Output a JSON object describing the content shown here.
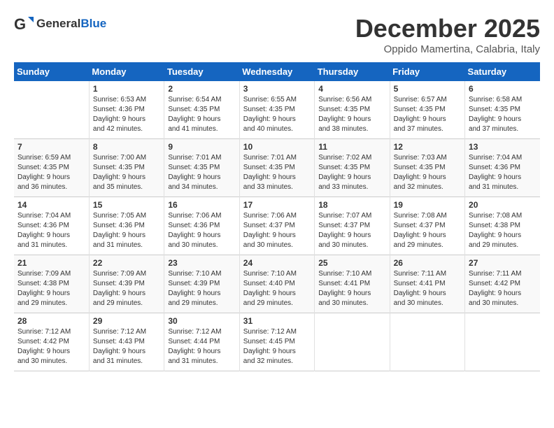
{
  "header": {
    "logo_general": "General",
    "logo_blue": "Blue",
    "month_title": "December 2025",
    "location": "Oppido Mamertina, Calabria, Italy"
  },
  "weekdays": [
    "Sunday",
    "Monday",
    "Tuesday",
    "Wednesday",
    "Thursday",
    "Friday",
    "Saturday"
  ],
  "weeks": [
    [
      {
        "day": "",
        "info": ""
      },
      {
        "day": "1",
        "info": "Sunrise: 6:53 AM\nSunset: 4:36 PM\nDaylight: 9 hours\nand 42 minutes."
      },
      {
        "day": "2",
        "info": "Sunrise: 6:54 AM\nSunset: 4:35 PM\nDaylight: 9 hours\nand 41 minutes."
      },
      {
        "day": "3",
        "info": "Sunrise: 6:55 AM\nSunset: 4:35 PM\nDaylight: 9 hours\nand 40 minutes."
      },
      {
        "day": "4",
        "info": "Sunrise: 6:56 AM\nSunset: 4:35 PM\nDaylight: 9 hours\nand 38 minutes."
      },
      {
        "day": "5",
        "info": "Sunrise: 6:57 AM\nSunset: 4:35 PM\nDaylight: 9 hours\nand 37 minutes."
      },
      {
        "day": "6",
        "info": "Sunrise: 6:58 AM\nSunset: 4:35 PM\nDaylight: 9 hours\nand 37 minutes."
      }
    ],
    [
      {
        "day": "7",
        "info": "Sunrise: 6:59 AM\nSunset: 4:35 PM\nDaylight: 9 hours\nand 36 minutes."
      },
      {
        "day": "8",
        "info": "Sunrise: 7:00 AM\nSunset: 4:35 PM\nDaylight: 9 hours\nand 35 minutes."
      },
      {
        "day": "9",
        "info": "Sunrise: 7:01 AM\nSunset: 4:35 PM\nDaylight: 9 hours\nand 34 minutes."
      },
      {
        "day": "10",
        "info": "Sunrise: 7:01 AM\nSunset: 4:35 PM\nDaylight: 9 hours\nand 33 minutes."
      },
      {
        "day": "11",
        "info": "Sunrise: 7:02 AM\nSunset: 4:35 PM\nDaylight: 9 hours\nand 33 minutes."
      },
      {
        "day": "12",
        "info": "Sunrise: 7:03 AM\nSunset: 4:35 PM\nDaylight: 9 hours\nand 32 minutes."
      },
      {
        "day": "13",
        "info": "Sunrise: 7:04 AM\nSunset: 4:36 PM\nDaylight: 9 hours\nand 31 minutes."
      }
    ],
    [
      {
        "day": "14",
        "info": "Sunrise: 7:04 AM\nSunset: 4:36 PM\nDaylight: 9 hours\nand 31 minutes."
      },
      {
        "day": "15",
        "info": "Sunrise: 7:05 AM\nSunset: 4:36 PM\nDaylight: 9 hours\nand 31 minutes."
      },
      {
        "day": "16",
        "info": "Sunrise: 7:06 AM\nSunset: 4:36 PM\nDaylight: 9 hours\nand 30 minutes."
      },
      {
        "day": "17",
        "info": "Sunrise: 7:06 AM\nSunset: 4:37 PM\nDaylight: 9 hours\nand 30 minutes."
      },
      {
        "day": "18",
        "info": "Sunrise: 7:07 AM\nSunset: 4:37 PM\nDaylight: 9 hours\nand 30 minutes."
      },
      {
        "day": "19",
        "info": "Sunrise: 7:08 AM\nSunset: 4:37 PM\nDaylight: 9 hours\nand 29 minutes."
      },
      {
        "day": "20",
        "info": "Sunrise: 7:08 AM\nSunset: 4:38 PM\nDaylight: 9 hours\nand 29 minutes."
      }
    ],
    [
      {
        "day": "21",
        "info": "Sunrise: 7:09 AM\nSunset: 4:38 PM\nDaylight: 9 hours\nand 29 minutes."
      },
      {
        "day": "22",
        "info": "Sunrise: 7:09 AM\nSunset: 4:39 PM\nDaylight: 9 hours\nand 29 minutes."
      },
      {
        "day": "23",
        "info": "Sunrise: 7:10 AM\nSunset: 4:39 PM\nDaylight: 9 hours\nand 29 minutes."
      },
      {
        "day": "24",
        "info": "Sunrise: 7:10 AM\nSunset: 4:40 PM\nDaylight: 9 hours\nand 29 minutes."
      },
      {
        "day": "25",
        "info": "Sunrise: 7:10 AM\nSunset: 4:41 PM\nDaylight: 9 hours\nand 30 minutes."
      },
      {
        "day": "26",
        "info": "Sunrise: 7:11 AM\nSunset: 4:41 PM\nDaylight: 9 hours\nand 30 minutes."
      },
      {
        "day": "27",
        "info": "Sunrise: 7:11 AM\nSunset: 4:42 PM\nDaylight: 9 hours\nand 30 minutes."
      }
    ],
    [
      {
        "day": "28",
        "info": "Sunrise: 7:12 AM\nSunset: 4:42 PM\nDaylight: 9 hours\nand 30 minutes."
      },
      {
        "day": "29",
        "info": "Sunrise: 7:12 AM\nSunset: 4:43 PM\nDaylight: 9 hours\nand 31 minutes."
      },
      {
        "day": "30",
        "info": "Sunrise: 7:12 AM\nSunset: 4:44 PM\nDaylight: 9 hours\nand 31 minutes."
      },
      {
        "day": "31",
        "info": "Sunrise: 7:12 AM\nSunset: 4:45 PM\nDaylight: 9 hours\nand 32 minutes."
      },
      {
        "day": "",
        "info": ""
      },
      {
        "day": "",
        "info": ""
      },
      {
        "day": "",
        "info": ""
      }
    ]
  ]
}
